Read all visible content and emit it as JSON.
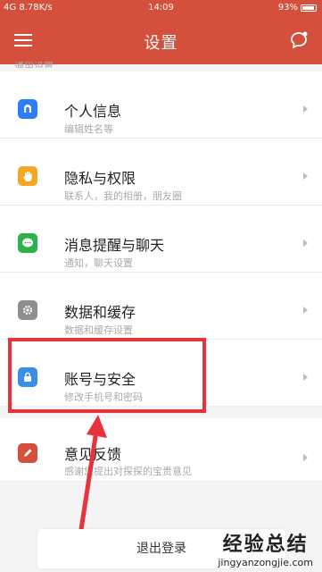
{
  "status_bar": {
    "signal": "4G",
    "speed": "8.78K/s",
    "time": "14:09",
    "battery": "93%"
  },
  "header": {
    "title": "设置",
    "menu_icon": "menu-icon",
    "chat_icon": "chat-bubble-icon"
  },
  "section_label": "通用设置",
  "items": [
    {
      "title": "个人信息",
      "subtitle": "编辑姓名等",
      "icon": "user-icon",
      "color": "#2e7cf6"
    },
    {
      "title": "隐私与权限",
      "subtitle": "联系人，我的相册，朋友圈",
      "icon": "hand-icon",
      "color": "#f5a623"
    },
    {
      "title": "消息提醒与聊天",
      "subtitle": "通知，聊天设置",
      "icon": "message-icon",
      "color": "#2db24a"
    },
    {
      "title": "数据和缓存",
      "subtitle": "数据和缓存设置",
      "icon": "gear-icon",
      "color": "#8e8e8e"
    },
    {
      "title": "账号与安全",
      "subtitle": "修改手机号和密码",
      "icon": "lock-icon",
      "color": "#3a8ee6"
    }
  ],
  "feedback": {
    "title": "意见反馈",
    "subtitle": "感谢您提出对探探的宝贵意见",
    "icon": "pencil-icon",
    "color": "#d4503c"
  },
  "logout_label": "退出登录",
  "watermark": {
    "big": "经验总结",
    "small": "jingyanzongjie.com"
  },
  "highlight_color": "#e8333a"
}
